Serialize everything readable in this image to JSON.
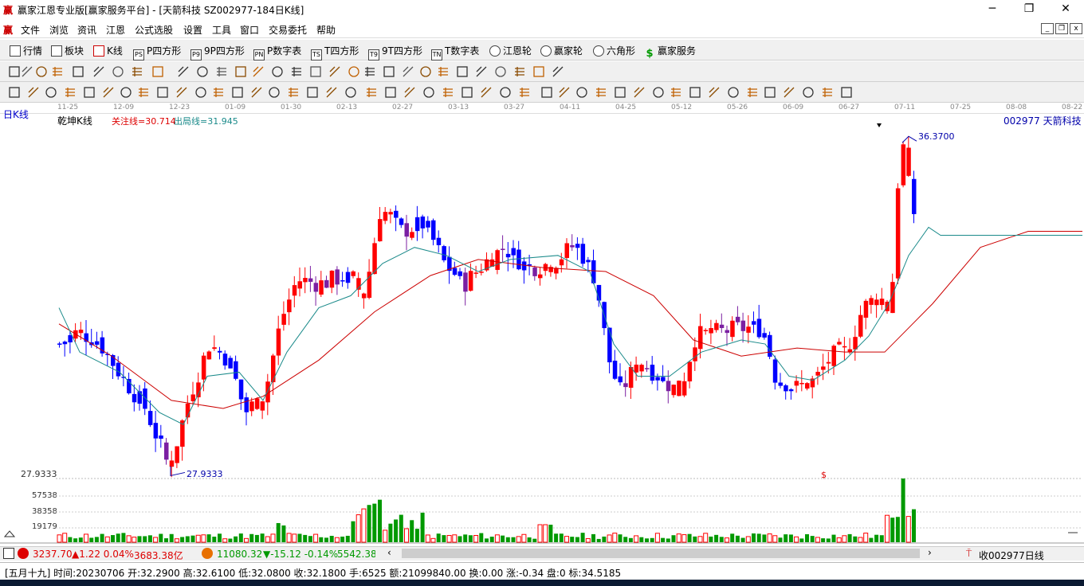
{
  "window": {
    "logo_text": "赢",
    "title": "赢家江恩专业版[赢家服务平台] - [天箭科技  SZ002977-184日K线]",
    "min_label": "─",
    "max_label": "❐",
    "close_label": "✕"
  },
  "menu": {
    "logo_text": "赢",
    "items": [
      "文件",
      "浏览",
      "资讯",
      "江恩",
      "公式选股",
      "设置",
      "工具",
      "窗口",
      "交易委托",
      "帮助"
    ]
  },
  "toolbar1": {
    "items": [
      {
        "icon": "list-grid-icon",
        "badge": "",
        "label": "行情"
      },
      {
        "icon": "blocks-icon",
        "badge": "",
        "label": "板块"
      },
      {
        "icon": "candle-icon",
        "badge": "",
        "label": "K线"
      },
      {
        "icon": "p-square-icon",
        "badge": "PS",
        "label": "P四方形"
      },
      {
        "icon": "9p-square-icon",
        "badge": "P9",
        "label": "9P四方形"
      },
      {
        "icon": "p-number-icon",
        "badge": "PN",
        "label": "P数字表"
      },
      {
        "icon": "t-square-icon",
        "badge": "TS",
        "label": "T四方形"
      },
      {
        "icon": "9t-square-icon",
        "badge": "T9",
        "label": "9T四方形"
      },
      {
        "icon": "t-number-icon",
        "badge": "TN",
        "label": "T数字表"
      },
      {
        "icon": "gann-wheel-icon",
        "badge": "",
        "label": "江恩轮"
      },
      {
        "icon": "winner-wheel-icon",
        "badge": "",
        "label": "赢家轮"
      },
      {
        "icon": "hexagon-icon",
        "badge": "",
        "label": "六角形"
      },
      {
        "icon": "dollar-icon",
        "badge": "$",
        "label": "赢家服务"
      }
    ]
  },
  "chart": {
    "period_label": "日K线",
    "indicator_name": "乾坤K线",
    "focus_line": "关注线=30.714",
    "exit_line": "出局线=31.945",
    "stock_label": "002977  天箭科技",
    "high_marker": "36.3700",
    "low_marker": "27.9333",
    "axis_top_value": "27.9333",
    "vol_ticks": [
      "57538",
      "38358",
      "19179"
    ],
    "dollar_marker": "$",
    "colors": {
      "up": "#ff0000",
      "down": "#0000ff",
      "neutral": "#7b1fa2",
      "ma_red": "#cc0000",
      "ma_teal": "#1a8a8a",
      "vol_green": "#009900"
    },
    "time_labels": [
      "11-25",
      "12-09",
      "12-23",
      "01-09",
      "01-30",
      "02-13",
      "02-27",
      "03-13",
      "03-27",
      "04-11",
      "04-25",
      "05-12",
      "05-26",
      "06-09",
      "06-27",
      "07-11",
      "07-25",
      "08-08",
      "08-22"
    ]
  },
  "market_bar": {
    "sh_index": "3237.70",
    "sh_change": "▲1.22 0.04%",
    "sh_amount": "3683.38亿",
    "sz_index": "11080.32",
    "sz_change": "▼-15.12 -0.14%",
    "sz_amount": "5542.38",
    "right_text": "收002977日线"
  },
  "statusbar": {
    "text": "[五月十九] 时间:20230706 开:32.2900 高:32.6100 低:32.0800 收:32.1800 手:6525 额:21099840.00 换:0.00 涨:-0.34 盘:0 标:34.5185"
  }
}
